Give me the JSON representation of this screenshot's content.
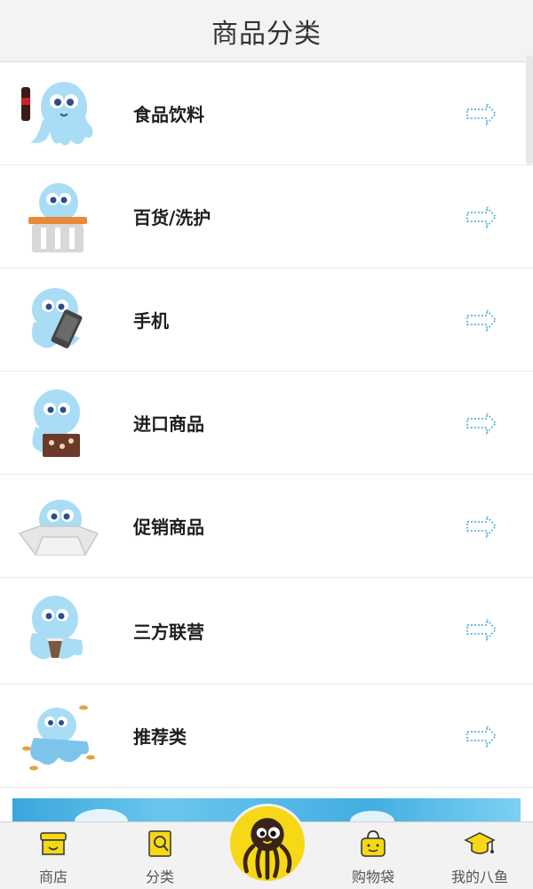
{
  "header": {
    "title": "商品分类"
  },
  "categories": [
    {
      "label": "食品饮料",
      "icon": "octopus-cola-icon"
    },
    {
      "label": "百货/洗护",
      "icon": "octopus-basket-icon"
    },
    {
      "label": "手机",
      "icon": "octopus-phone-icon"
    },
    {
      "label": "进口商品",
      "icon": "octopus-chocolate-icon"
    },
    {
      "label": "促销商品",
      "icon": "octopus-box-icon"
    },
    {
      "label": "三方联营",
      "icon": "octopus-drink-icon"
    },
    {
      "label": "推荐类",
      "icon": "octopus-leaves-icon"
    }
  ],
  "tabbar": {
    "items": [
      {
        "label": "商店",
        "icon": "store-icon"
      },
      {
        "label": "分类",
        "icon": "category-icon"
      },
      {
        "label": "",
        "icon": "octopus-center-icon"
      },
      {
        "label": "购物袋",
        "icon": "shopping-bag-icon"
      },
      {
        "label": "我的八鱼",
        "icon": "graduation-cap-icon"
      }
    ]
  },
  "colors": {
    "octopus": "#a9dcf5",
    "arrow": "#6fb9e4",
    "accent": "#f6d816",
    "header_bg": "#f3f3f3"
  }
}
